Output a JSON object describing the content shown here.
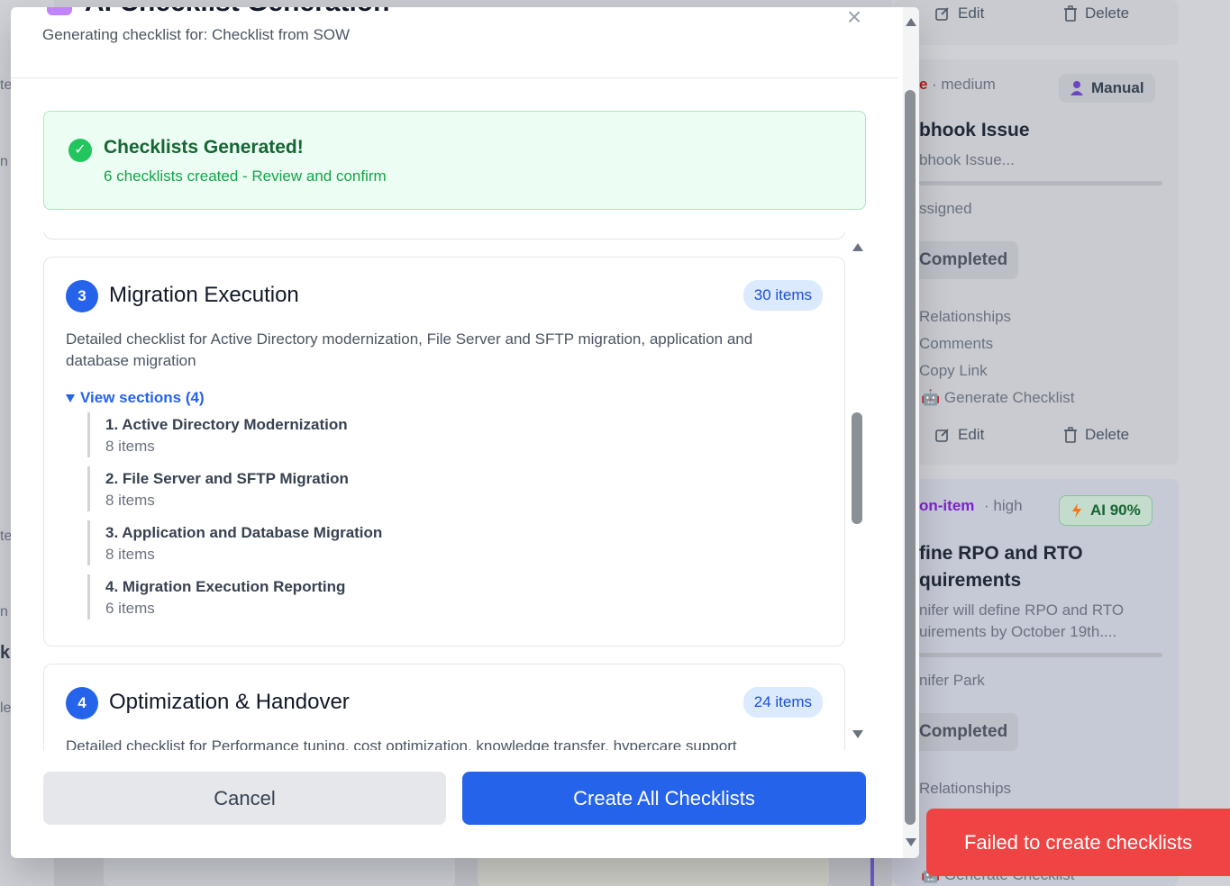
{
  "modal": {
    "title": "AI Checklist Generation",
    "subtitle": "Generating checklist for: Checklist from SOW",
    "close_symbol": "×",
    "success": {
      "icon": "✓",
      "title": "Checklists Generated!",
      "subtitle": "6 checklists created - Review and confirm"
    },
    "checklists": [
      {
        "number": "3",
        "title": "Migration Execution",
        "count": "30 items",
        "description": "Detailed checklist for Active Directory modernization, File Server and SFTP migration, application and database migration",
        "toggle_label": "View sections (4)",
        "sections": [
          {
            "name": "1. Active Directory Modernization",
            "count": "8 items"
          },
          {
            "name": "2. File Server and SFTP Migration",
            "count": "8 items"
          },
          {
            "name": "3. Application and Database Migration",
            "count": "8 items"
          },
          {
            "name": "4. Migration Execution Reporting",
            "count": "6 items"
          }
        ]
      },
      {
        "number": "4",
        "title": "Optimization & Handover",
        "count": "24 items",
        "description": "Detailed checklist for Performance tuning, cost optimization, knowledge transfer, hypercare support"
      }
    ],
    "cancel_label": "Cancel",
    "create_label": "Create All Checklists"
  },
  "toast": {
    "message": "Failed to create checklists"
  },
  "background": {
    "top_actions": {
      "edit": "Edit",
      "delete": "Delete"
    },
    "card1": {
      "type_fragment": "e",
      "priority": "· medium",
      "badge": "Manual",
      "title": "bhook Issue",
      "desc": "bhook Issue...",
      "assignee": "ssigned",
      "status": "Completed",
      "links": [
        "Relationships",
        "Comments",
        "Copy Link",
        "Generate Checklist"
      ],
      "edit": "Edit",
      "delete": "Delete"
    },
    "card2": {
      "type_fragment": "on-item",
      "priority": "· high",
      "badge": "AI 90%",
      "title_line1": "fine RPO and RTO",
      "title_line2": "quirements",
      "desc_line1": "nifer will define RPO and RTO",
      "desc_line2": "uirements by October 19th....",
      "assignee": "nifer Park",
      "status": "Completed",
      "links": [
        "Relationships",
        "Generate Checklist"
      ]
    },
    "left_fragments": [
      "te",
      "n",
      "te",
      "n",
      "k",
      "le"
    ]
  },
  "colors": {
    "primary": "#2563eb",
    "success": "#22c55e",
    "toast": "#ef4444"
  }
}
